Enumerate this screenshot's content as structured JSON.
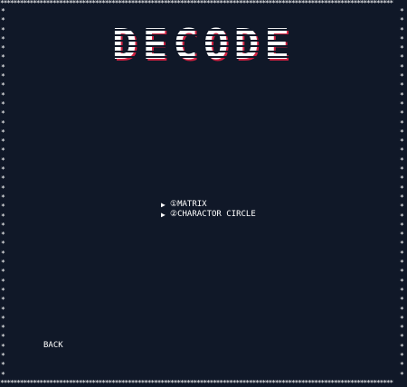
{
  "border": {
    "glyph": "*",
    "color": "#ffffff"
  },
  "title": "DECODE",
  "menu": {
    "items": [
      {
        "arrow": "▶",
        "label": "①MATRIX"
      },
      {
        "arrow": "▶",
        "label": "②CHARACTOR CIRCLE"
      }
    ]
  },
  "back_label": "BACK",
  "colors": {
    "background": "#101828",
    "text": "#ffffff",
    "title_shadow": "#d02040"
  }
}
